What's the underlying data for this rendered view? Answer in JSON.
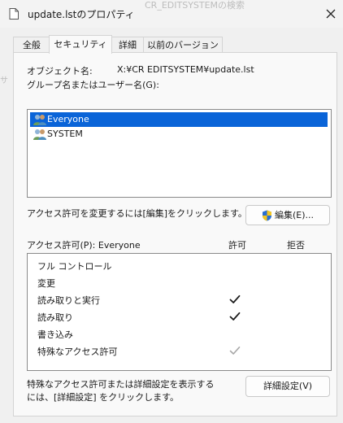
{
  "window": {
    "title": "update.lstのプロパティ",
    "background_title": "CR_EDITSYSTEMの検索"
  },
  "tabs": [
    {
      "label": "全般"
    },
    {
      "label": "セキュリティ"
    },
    {
      "label": "詳細"
    },
    {
      "label": "以前のバージョン"
    }
  ],
  "security": {
    "object_label": "オブジェクト名:",
    "object_value": "X:¥CR EDITSYSTEM¥update.lst",
    "groups_label": "グループ名またはユーザー名(G):",
    "groups": [
      {
        "name": "Everyone",
        "selected": true,
        "icon": "users-group-icon"
      },
      {
        "name": "SYSTEM",
        "selected": false,
        "icon": "users-group-icon"
      }
    ],
    "change_hint": "アクセス許可を変更するには[編集]をクリックします。",
    "edit_button": "編集(E)...",
    "perm_header": "アクセス許可(P): Everyone",
    "allow_header": "許可",
    "deny_header": "拒否",
    "permissions": [
      {
        "name": "フル コントロール",
        "allow": "none",
        "deny": "none"
      },
      {
        "name": "変更",
        "allow": "none",
        "deny": "none"
      },
      {
        "name": "読み取りと実行",
        "allow": "checked",
        "deny": "none"
      },
      {
        "name": "読み取り",
        "allow": "checked",
        "deny": "none"
      },
      {
        "name": "書き込み",
        "allow": "none",
        "deny": "none"
      },
      {
        "name": "特殊なアクセス許可",
        "allow": "inherited",
        "deny": "none"
      }
    ],
    "advanced_hint_line1": "特殊なアクセス許可または詳細設定を表示する",
    "advanced_hint_line2": "には、[詳細設定] をクリックします。",
    "advanced_button": "詳細設定(V)"
  },
  "left_edge_text": "サ",
  "colors": {
    "selection": "#0a64d8",
    "check": "#1a1a1a",
    "check_inherited": "#a8a8a8"
  }
}
